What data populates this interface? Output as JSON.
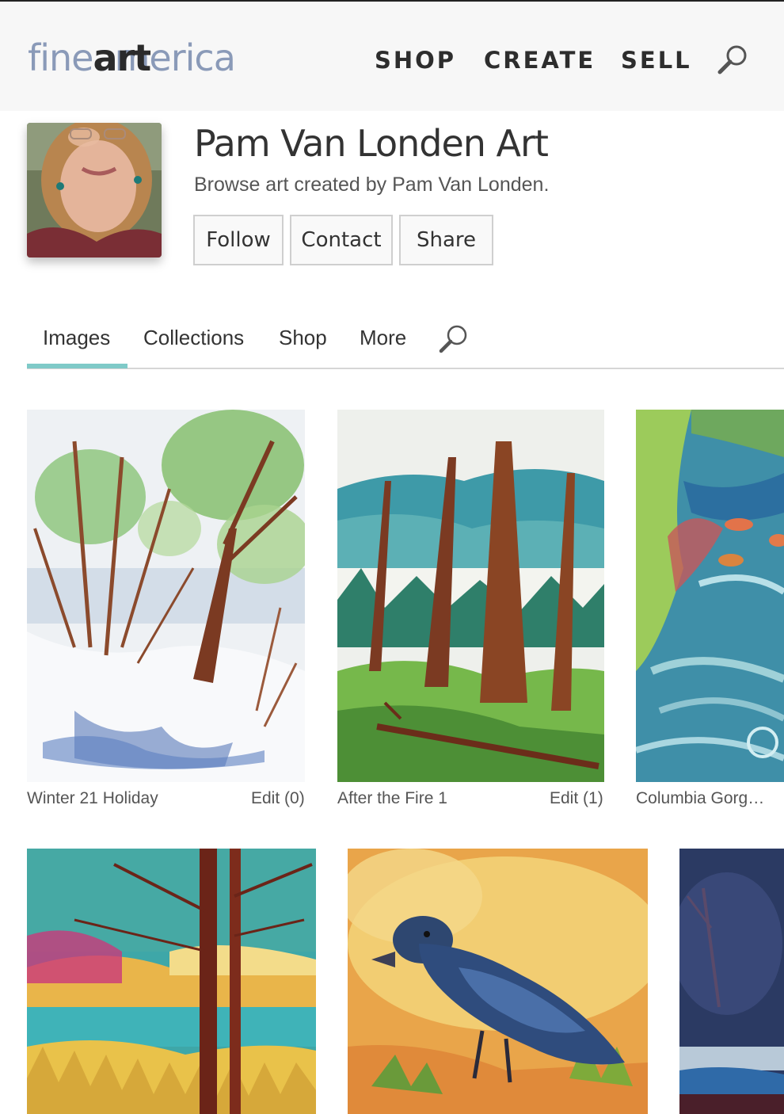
{
  "header": {
    "logo_pre": "fine",
    "logo_bold": "art",
    "logo_post": "america",
    "nav": {
      "shop": "SHOP",
      "create": "CREATE",
      "sell": "SELL"
    }
  },
  "profile": {
    "name": "Pam Van Londen Art",
    "subtitle": "Browse art created by Pam Van Londen.",
    "buttons": {
      "follow": "Follow",
      "contact": "Contact",
      "share": "Share"
    }
  },
  "tabs": {
    "images": "Images",
    "collections": "Collections",
    "shop": "Shop",
    "more": "More"
  },
  "artworks": [
    {
      "title": "Winter 21 Holiday",
      "edit": "Edit (0)"
    },
    {
      "title": "After the Fire 1",
      "edit": "Edit (1)"
    },
    {
      "title": "Columbia Gorg…"
    }
  ],
  "colors": {
    "accent": "#7fcac8",
    "logo_light": "#8a9ab8",
    "logo_dark": "#2b2b2b"
  }
}
